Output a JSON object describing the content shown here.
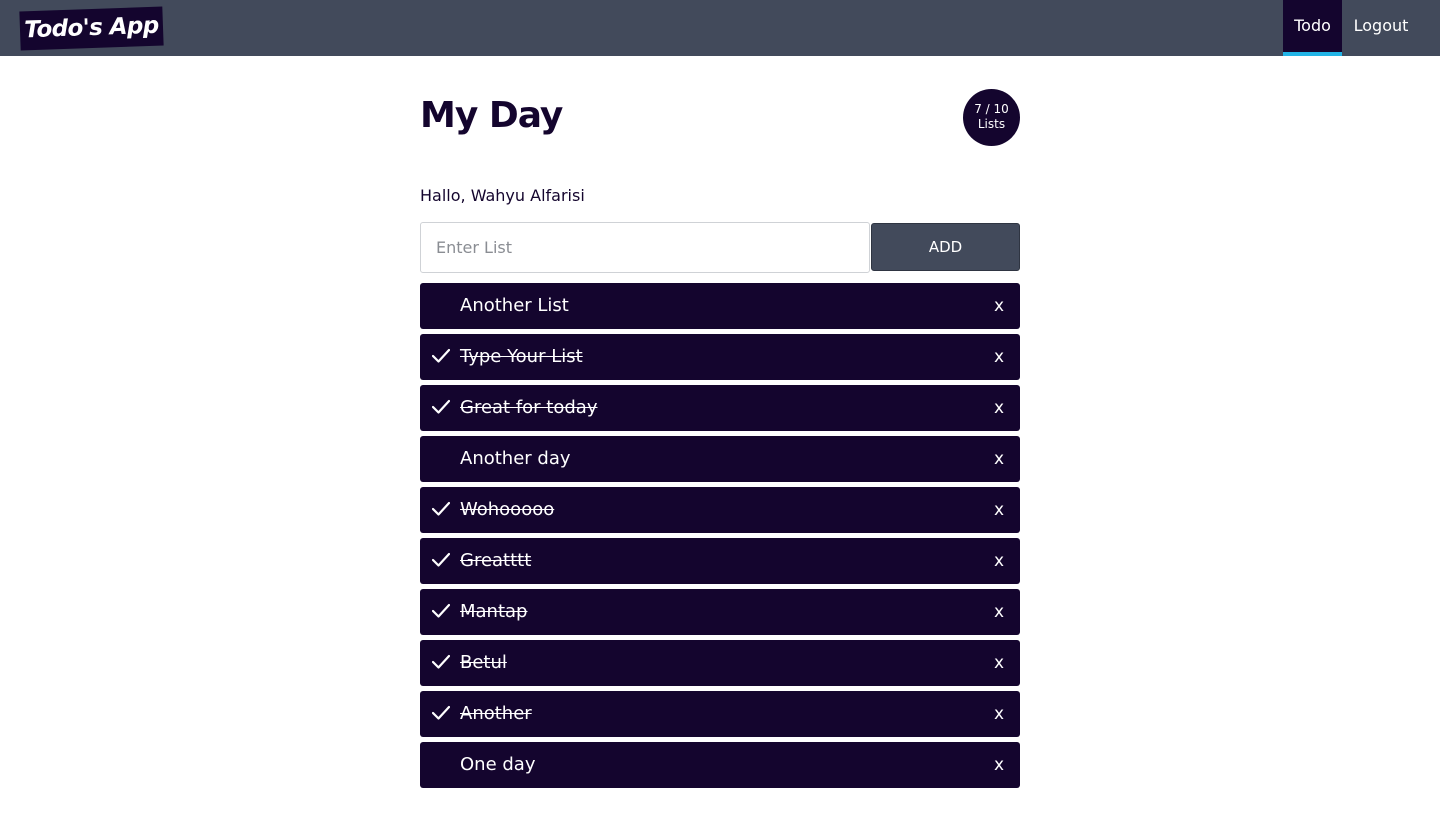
{
  "navbar": {
    "brand": "Todo's App",
    "links": [
      {
        "label": "Todo",
        "active": true
      },
      {
        "label": "Logout",
        "active": false
      }
    ]
  },
  "header": {
    "title": "My Day",
    "counter": {
      "fraction": "7 / 10",
      "unit": "Lists"
    }
  },
  "greeting": "Hallo, Wahyu Alfarisi",
  "form": {
    "placeholder": "Enter List",
    "value": "",
    "add_label": "ADD"
  },
  "todos": [
    {
      "text": "Another List",
      "done": false,
      "delete_label": "x"
    },
    {
      "text": "Type Your List",
      "done": true,
      "delete_label": "x"
    },
    {
      "text": "Great for today",
      "done": true,
      "delete_label": "x"
    },
    {
      "text": "Another day",
      "done": false,
      "delete_label": "x"
    },
    {
      "text": "Wohooooo",
      "done": true,
      "delete_label": "x"
    },
    {
      "text": "Greatttt",
      "done": true,
      "delete_label": "x"
    },
    {
      "text": "Mantap",
      "done": true,
      "delete_label": "x"
    },
    {
      "text": "Betul",
      "done": true,
      "delete_label": "x"
    },
    {
      "text": "Another",
      "done": true,
      "delete_label": "x"
    },
    {
      "text": "One day",
      "done": false,
      "delete_label": "x"
    }
  ],
  "colors": {
    "navbar": "#424a5b",
    "primary": "#14052e",
    "accent": "#22b4e6"
  },
  "icons": {
    "done": "check-icon"
  }
}
